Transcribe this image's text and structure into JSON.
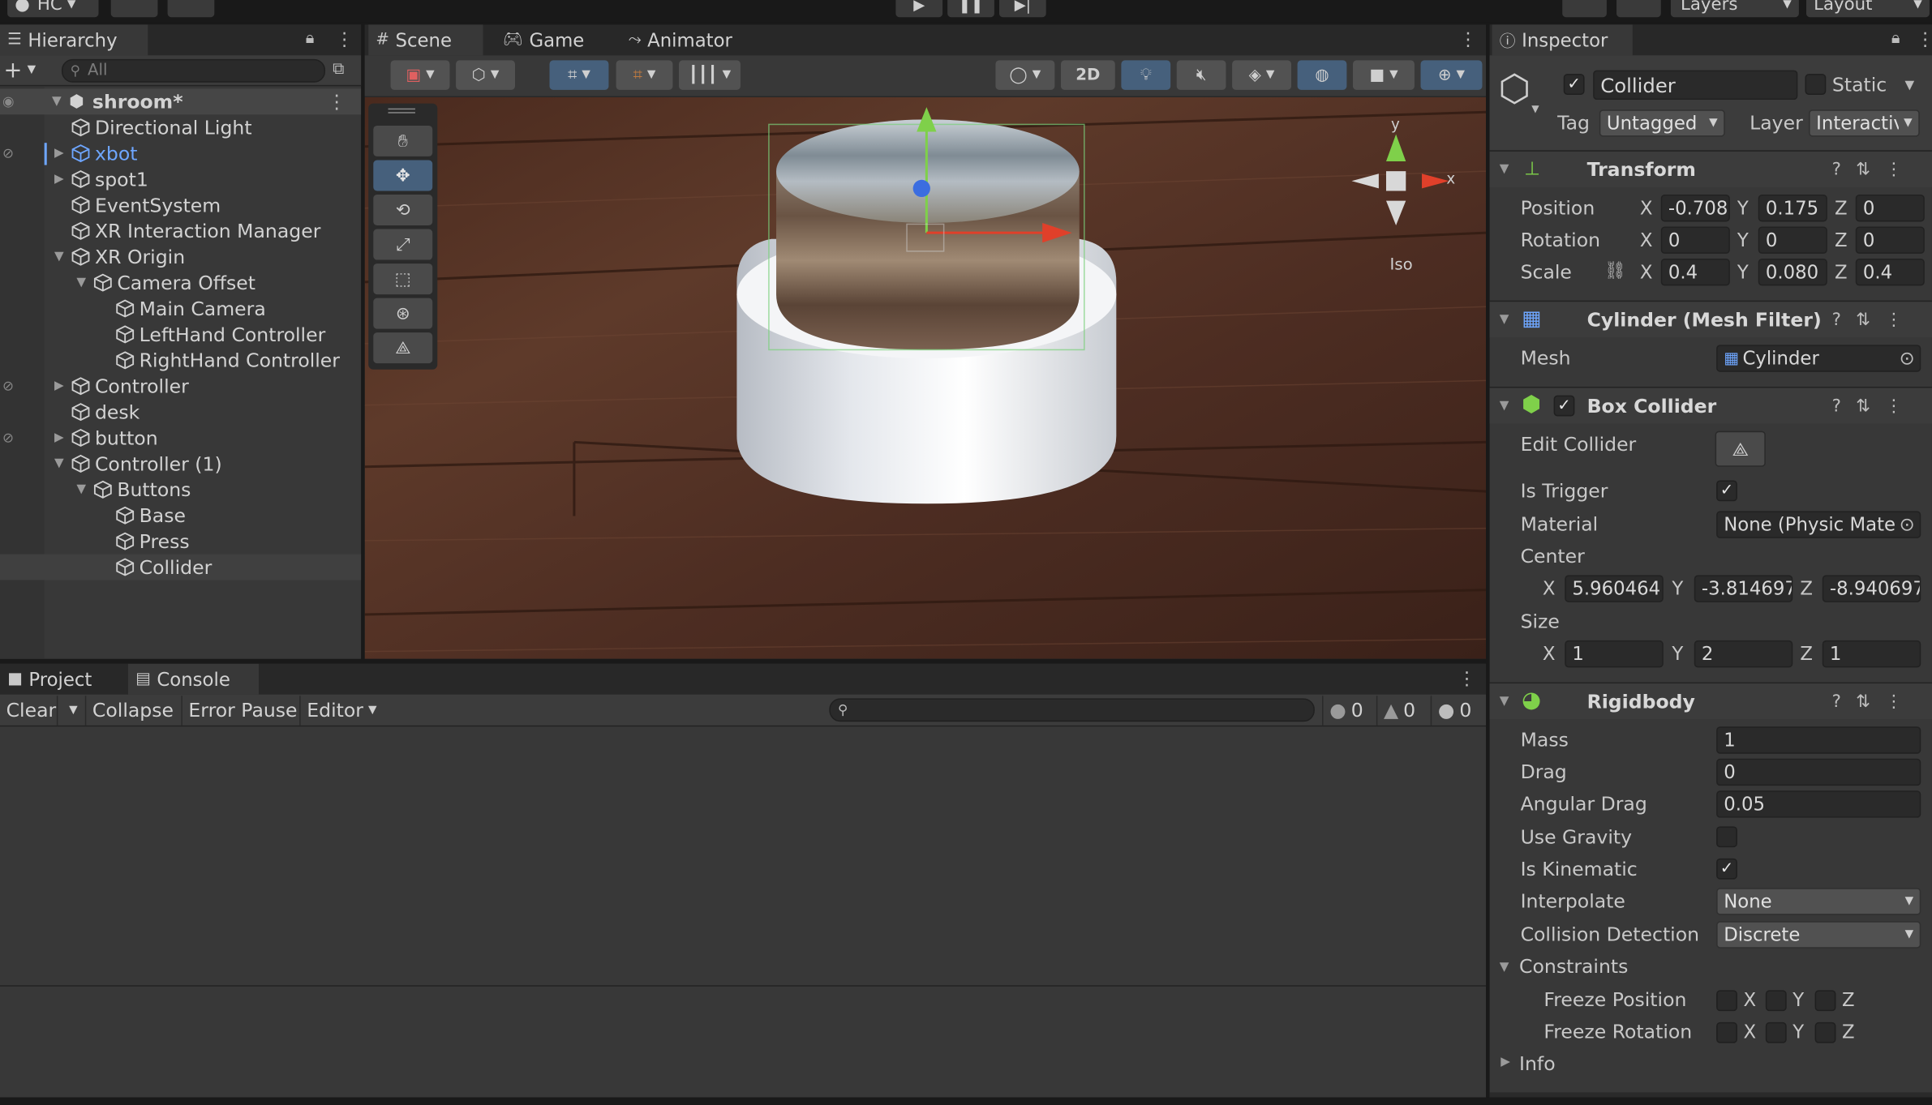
{
  "colors": {
    "accent": "#46607c",
    "selection": "#404040",
    "link_blue": "#6ea6ff",
    "panel": "#383838",
    "editor_bg": "#191919"
  },
  "top": {
    "account": "HC",
    "layers": "Layers",
    "layout": "Layout"
  },
  "hierarchy": {
    "tab": "Hierarchy",
    "search_placeholder": "All",
    "scene": "shroom*",
    "items": [
      {
        "label": "Directional Light"
      },
      {
        "label": "xbot"
      },
      {
        "label": "spot1"
      },
      {
        "label": "EventSystem"
      },
      {
        "label": "XR Interaction Manager"
      },
      {
        "label": "XR Origin"
      },
      {
        "label": "Camera Offset"
      },
      {
        "label": "Main Camera"
      },
      {
        "label": "LeftHand Controller"
      },
      {
        "label": "RightHand Controller"
      },
      {
        "label": "Controller"
      },
      {
        "label": "desk"
      },
      {
        "label": "button"
      },
      {
        "label": "Controller (1)"
      },
      {
        "label": "Buttons"
      },
      {
        "label": "Base"
      },
      {
        "label": "Press"
      },
      {
        "label": "Collider"
      }
    ]
  },
  "scene": {
    "tabs": {
      "scene": "Scene",
      "game": "Game",
      "animator": "Animator"
    },
    "btn_2d": "2D",
    "gizmo": {
      "y": "y",
      "x": "x",
      "iso": "Iso"
    }
  },
  "console": {
    "tabs": {
      "project": "Project",
      "console": "Console"
    },
    "clear": "Clear",
    "collapse": "Collapse",
    "error_pause": "Error Pause",
    "editor": "Editor",
    "count_log": "0",
    "count_warn": "0",
    "count_error": "0"
  },
  "inspector": {
    "tab": "Inspector",
    "object_name": "Collider",
    "static_label": "Static",
    "tag_label": "Tag",
    "tag_value": "Untagged",
    "layer_label": "Layer",
    "layer_value": "Interactiv",
    "transform": {
      "title": "Transform",
      "position": "Position",
      "rotation": "Rotation",
      "scale": "Scale",
      "px": "-0.708",
      "py": "0.175",
      "pz": "0",
      "rx": "0",
      "ry": "0",
      "rz": "0",
      "sx": "0.4",
      "sy": "0.080",
      "sz": "0.4"
    },
    "mesh_filter": {
      "title": "Cylinder (Mesh Filter)",
      "mesh_label": "Mesh",
      "mesh_value": "Cylinder"
    },
    "box_collider": {
      "title": "Box Collider",
      "edit_collider": "Edit Collider",
      "is_trigger": "Is Trigger",
      "material": "Material",
      "material_value": "None (Physic Mate",
      "center": "Center",
      "cx": "5.960464",
      "cy": "-3.814697",
      "cz": "-8.940697",
      "size": "Size",
      "sx": "1",
      "sy": "2",
      "sz": "1"
    },
    "rigidbody": {
      "title": "Rigidbody",
      "mass": "Mass",
      "mass_value": "1",
      "drag": "Drag",
      "drag_value": "0",
      "angular_drag": "Angular Drag",
      "angular_drag_value": "0.05",
      "use_gravity": "Use Gravity",
      "is_kinematic": "Is Kinematic",
      "interpolate": "Interpolate",
      "interpolate_value": "None",
      "collision_detection": "Collision Detection",
      "collision_detection_value": "Discrete",
      "constraints": "Constraints",
      "freeze_position": "Freeze Position",
      "freeze_rotation": "Freeze Rotation",
      "info": "Info"
    },
    "axes": {
      "x": "X",
      "y": "Y",
      "z": "Z"
    }
  }
}
